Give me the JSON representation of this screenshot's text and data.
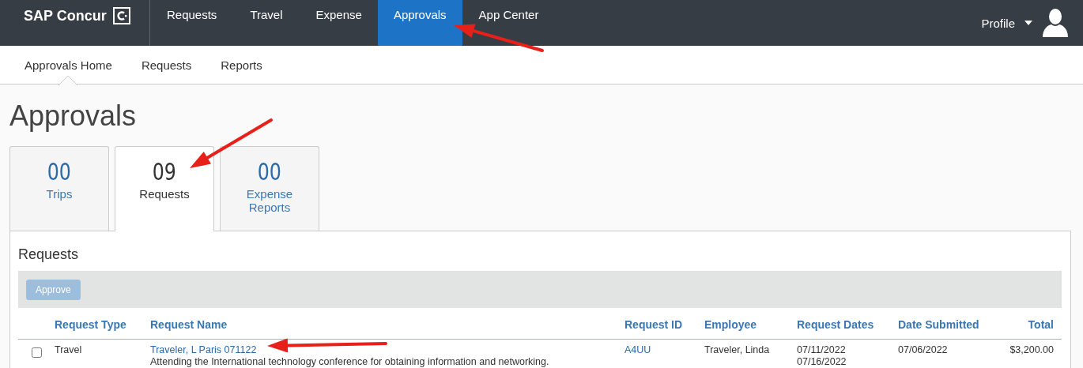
{
  "brand": {
    "name": "SAP Concur"
  },
  "nav": [
    {
      "label": "Requests",
      "selected": false
    },
    {
      "label": "Travel",
      "selected": false
    },
    {
      "label": "Expense",
      "selected": false
    },
    {
      "label": "Approvals",
      "selected": true
    },
    {
      "label": "App Center",
      "selected": false
    }
  ],
  "profile": {
    "label": "Profile"
  },
  "subnav": [
    {
      "label": "Approvals Home",
      "selected": true
    },
    {
      "label": "Requests",
      "selected": false
    },
    {
      "label": "Reports",
      "selected": false
    }
  ],
  "page_title": "Approvals",
  "tiles": [
    {
      "count": "00",
      "label": "Trips",
      "selected": false
    },
    {
      "count": "09",
      "label": "Requests",
      "selected": true
    },
    {
      "count": "00",
      "label": "Expense Reports",
      "selected": false
    }
  ],
  "panel": {
    "title": "Requests",
    "toolbar": {
      "buttons": [
        {
          "label": "Approve",
          "disabled": true
        }
      ]
    },
    "table": {
      "columns": [
        "Request Type",
        "Request Name",
        "Request ID",
        "Employee",
        "Request Dates",
        "Date Submitted",
        "Total"
      ],
      "rows": [
        {
          "checked": false,
          "request_type": "Travel",
          "request_name": "Traveler, L Paris 071122",
          "description": "Attending the International technology conference for obtaining information and networking.",
          "request_id": "A4UU",
          "employee": "Traveler, Linda",
          "request_dates": [
            "07/11/2022",
            "07/16/2022"
          ],
          "date_submitted": "07/06/2022",
          "total": "$3,200.00"
        }
      ]
    }
  }
}
